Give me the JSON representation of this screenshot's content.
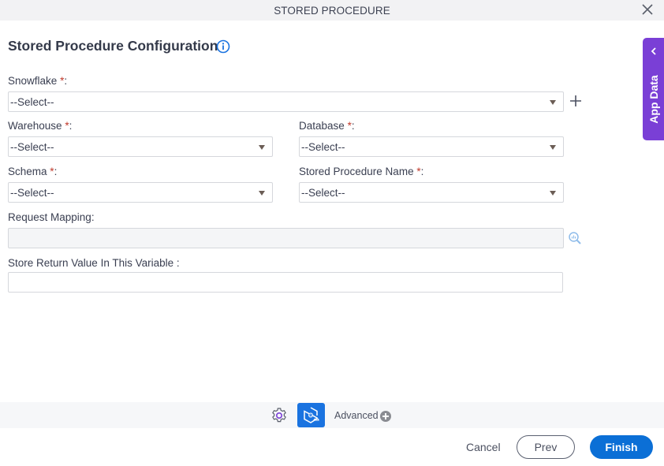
{
  "titlebar": {
    "title": "STORED PROCEDURE",
    "close_icon": "close-icon"
  },
  "page": {
    "title": "Stored Procedure Configuration",
    "info_icon": "info-icon"
  },
  "fields": {
    "snowflake": {
      "label": "Snowflake",
      "required": "*",
      "suffix": ":",
      "value": "--Select--"
    },
    "warehouse": {
      "label": "Warehouse",
      "required": "*",
      "suffix": ":",
      "value": "--Select--"
    },
    "database": {
      "label": "Database",
      "required": "*",
      "suffix": ":",
      "value": "--Select--"
    },
    "schema": {
      "label": "Schema",
      "required": "*",
      "suffix": ":",
      "value": "--Select--"
    },
    "procedure_name": {
      "label": "Stored Procedure Name",
      "required": "*",
      "suffix": ":",
      "value": "--Select--"
    },
    "request_mapping": {
      "label": "Request Mapping:",
      "value": ""
    },
    "return_variable": {
      "label": "Store Return Value In This Variable :",
      "value": ""
    }
  },
  "side_panel": {
    "label": "App Data"
  },
  "bottom": {
    "advanced_label": "Advanced"
  },
  "footer": {
    "cancel": "Cancel",
    "prev": "Prev",
    "finish": "Finish"
  },
  "colors": {
    "accent": "#0b6fd6",
    "app_data": "#7a3fd6",
    "required": "#c0392b"
  }
}
